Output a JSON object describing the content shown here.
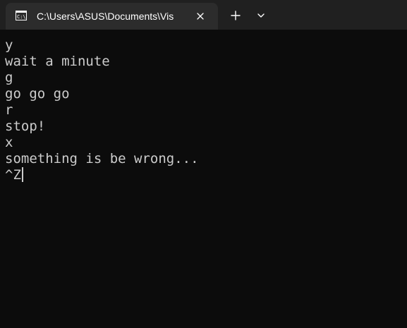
{
  "tab": {
    "title": "C:\\Users\\ASUS\\Documents\\Vis",
    "icon": "terminal-icon"
  },
  "toolbar": {
    "close_icon": "close-icon",
    "new_tab_icon": "plus-icon",
    "dropdown_icon": "chevron-down-icon"
  },
  "terminal": {
    "lines": [
      "y",
      "wait a minute",
      "g",
      "go go go",
      "r",
      "stop!",
      "x",
      "something is be wrong..."
    ],
    "input_line": "^Z"
  },
  "colors": {
    "background": "#0c0c0c",
    "tabbar": "#202020",
    "active_tab": "#2c2c2c",
    "text": "#cccccc"
  }
}
